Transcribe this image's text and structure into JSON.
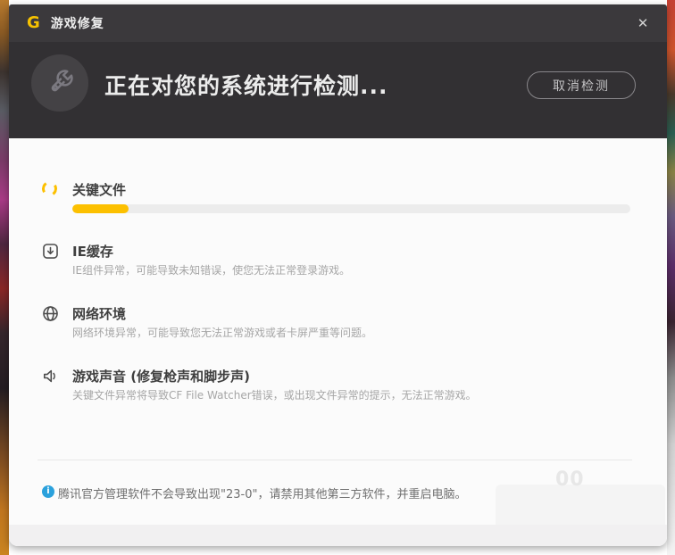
{
  "window": {
    "logo_glyph": "G",
    "title": "游戏修复",
    "close_glyph": "✕"
  },
  "header": {
    "status_text": "正在对您的系统进行检测...",
    "cancel_label": "取消检测",
    "icon": "wrench-icon"
  },
  "checks": [
    {
      "icon": "spinner-icon",
      "title": "关键文件",
      "progress_percent": 10
    },
    {
      "icon": "download-icon",
      "title": "IE缓存",
      "desc": "IE组件异常，可能导致未知错误，使您无法正常登录游戏。"
    },
    {
      "icon": "globe-icon",
      "title": "网络环境",
      "desc": "网络环境异常，可能导致您无法正常游戏或者卡屏严重等问题。"
    },
    {
      "icon": "speaker-icon",
      "title": "游戏声音 (修复枪声和脚步声)",
      "desc": "关键文件异常将导致CF File Watcher错误，或出现文件异常的提示，无法正常游戏。"
    }
  ],
  "footer": {
    "info_glyph": "i",
    "note": "腾讯官方管理软件不会导致出现\"23-0\"，请禁用其他第三方软件，并重启电脑。"
  },
  "watermark": "00",
  "colors": {
    "accent_yellow": "#fcc000",
    "titlebar_bg": "#3b393c",
    "header_bg": "#323033",
    "body_bg": "#fbfbfb",
    "info_blue": "#2ba1dc",
    "title_text": "#3f3f3f",
    "desc_text": "#a6a6a6"
  }
}
